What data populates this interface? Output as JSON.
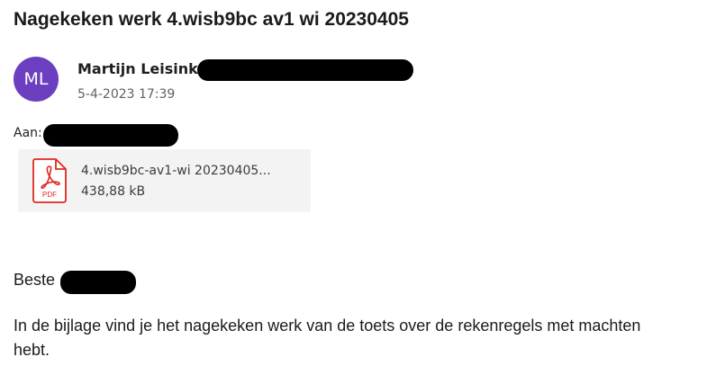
{
  "email": {
    "subject": "Nagekeken werk 4.wisb9bc av1 wi 20230405",
    "avatar_initials": "ML",
    "sender_name": "Martijn Leisink",
    "date": "5-4-2023 17:39",
    "to_label": "Aan:",
    "attachment": {
      "file_name": "4.wisb9bc-av1-wi 20230405...",
      "file_size": "438,88 kB",
      "icon": "pdf-icon",
      "icon_label": "PDF"
    },
    "greeting": "Beste",
    "body_line_1": "In de bijlage vind je het nagekeken werk van de toets over de rekenregels met machten",
    "body_line_2": "hebt."
  },
  "colors": {
    "avatar_bg": "#6b3fbf",
    "pdf_red": "#e0281f",
    "attachment_bg": "#f3f3f3",
    "redaction": "#000000"
  }
}
